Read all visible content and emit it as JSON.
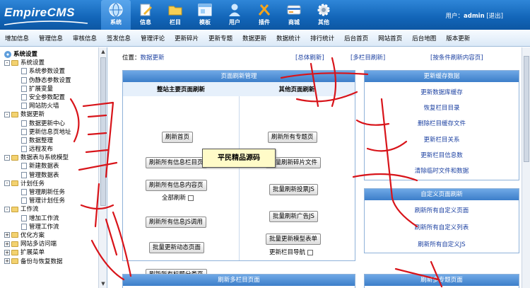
{
  "app": {
    "logo": "EmpireCMS"
  },
  "nav": [
    {
      "label": "系统",
      "icon": "globe-icon"
    },
    {
      "label": "信息",
      "icon": "document-edit-icon"
    },
    {
      "label": "栏目",
      "icon": "folder-icon"
    },
    {
      "label": "模板",
      "icon": "window-icon"
    },
    {
      "label": "用户",
      "icon": "user-icon"
    },
    {
      "label": "插件",
      "icon": "tools-icon"
    },
    {
      "label": "商城",
      "icon": "card-icon"
    },
    {
      "label": "其他",
      "icon": "gear-icon"
    }
  ],
  "user": {
    "prefix": "用户：",
    "name": "admin",
    "logout": "[退出]"
  },
  "submenu": [
    "增加信息",
    "管理信息",
    "审核信息",
    "签发信息",
    "管理评论",
    "更新碎片",
    "更新专题",
    "数据更新",
    "数据统计",
    "排行统计",
    "后台首页",
    "网站首页",
    "后台地图",
    "版本更新"
  ],
  "tree": [
    {
      "level": 0,
      "label": "系统设置",
      "type": "root"
    },
    {
      "level": 1,
      "label": "系统设置",
      "type": "folder",
      "pm": "-"
    },
    {
      "level": 2,
      "label": "系统参数设置",
      "type": "doc"
    },
    {
      "level": 2,
      "label": "伪静态参数设置",
      "type": "doc"
    },
    {
      "level": 2,
      "label": "扩展变量",
      "type": "doc"
    },
    {
      "level": 2,
      "label": "安全参数配置",
      "type": "doc"
    },
    {
      "level": 2,
      "label": "网站防火墙",
      "type": "doc"
    },
    {
      "level": 1,
      "label": "数据更新",
      "type": "folder",
      "pm": "-"
    },
    {
      "level": 2,
      "label": "数据更新中心",
      "type": "doc"
    },
    {
      "level": 2,
      "label": "更新信息页地址",
      "type": "doc"
    },
    {
      "level": 2,
      "label": "数据整理",
      "type": "doc"
    },
    {
      "level": 2,
      "label": "远程发布",
      "type": "doc"
    },
    {
      "level": 1,
      "label": "数据表与系统模型",
      "type": "folder",
      "pm": "-"
    },
    {
      "level": 2,
      "label": "新建数据表",
      "type": "doc"
    },
    {
      "level": 2,
      "label": "管理数据表",
      "type": "doc"
    },
    {
      "level": 1,
      "label": "计划任务",
      "type": "folder",
      "pm": "-"
    },
    {
      "level": 2,
      "label": "管理刷新任务",
      "type": "doc"
    },
    {
      "level": 2,
      "label": "管理计划任务",
      "type": "doc"
    },
    {
      "level": 1,
      "label": "工作流",
      "type": "folder",
      "pm": "-"
    },
    {
      "level": 2,
      "label": "增加工作流",
      "type": "doc"
    },
    {
      "level": 2,
      "label": "管理工作流",
      "type": "doc"
    },
    {
      "level": 1,
      "label": "优化方案",
      "type": "folder",
      "pm": "+"
    },
    {
      "level": 1,
      "label": "网站多访问端",
      "type": "folder",
      "pm": "+"
    },
    {
      "level": 1,
      "label": "扩展菜单",
      "type": "folder",
      "pm": "+"
    },
    {
      "level": 1,
      "label": "备份与恢复数据",
      "type": "folder",
      "pm": "+"
    }
  ],
  "location": {
    "prefix": "位置：",
    "link": "数据更新"
  },
  "toplinks": [
    "[总体刷新]",
    "[多栏目刷新]",
    "[按条件刷新内容页]"
  ],
  "refresh_panel": {
    "title": "页面刷新管理",
    "col1_title": "整站主要页面刷新",
    "col2_title": "其他页面刷新",
    "col1_buttons": [
      "刷新首页",
      "刷新所有信息栏目页",
      "刷新所有信息内容页",
      "刷新所有信息JS调用",
      "批量更新动态页面",
      "刷新所有标题分类页"
    ],
    "all_refresh_label": "全部刷新",
    "col2_buttons": [
      "刷新所有专题页",
      "批量刷新碎片文件",
      "批量刷新投票JS",
      "批量刷新广告JS",
      "批量更新模型表单",
      "批量更新反馈表单"
    ],
    "col_nav_label": "更新栏目导航"
  },
  "cache_panel": {
    "title": "更新缓存数据",
    "links": [
      "更新数据库缓存",
      "恢复栏目目录",
      "删除栏目缓存文件",
      "更新栏目关系",
      "更新栏目信息数",
      "清除临时文件和数据"
    ]
  },
  "custom_panel": {
    "title": "自定义页面刷新",
    "links": [
      "刷新所有自定义页面",
      "刷新所有自定义列表",
      "刷新所有自定义JS"
    ]
  },
  "bottom_panels": [
    "刷新多栏目页面",
    "刷新多专题页面"
  ],
  "tooltip": "平民精品源码",
  "colors": {
    "header": "#1265b8",
    "panel_head": "#3c7ec9",
    "link": "#1a3fa0",
    "scribble": "#d8141a"
  }
}
